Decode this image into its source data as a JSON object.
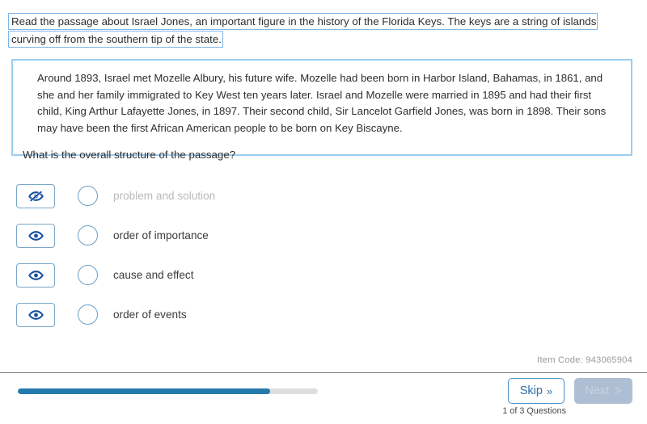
{
  "prompt": {
    "text": "Read the passage about Israel Jones, an important figure in the history of the Florida Keys. The keys are a string of islands curving off from the southern tip of the state."
  },
  "passage": {
    "body": "Around 1893, Israel met Mozelle Albury, his future wife. Mozelle had been born in Harbor Island, Bahamas, in 1861, and she and her family immigrated to Key West ten years later. Israel and Mozelle were married in 1895 and had their first child, King Arthur Lafayette Jones, in 1897. Their second child, Sir Lancelot Garfield Jones, was born in 1898. Their sons may have been the first African American people to be born on Key Biscayne.",
    "question": "What is the overall structure of the passage?"
  },
  "options": [
    {
      "label": "problem and solution",
      "eye_icon": "eye-off-icon",
      "eliminated": true,
      "selected": false
    },
    {
      "label": "order of importance",
      "eye_icon": "eye-icon",
      "eliminated": false,
      "selected": false
    },
    {
      "label": "cause and effect",
      "eye_icon": "eye-icon",
      "eliminated": false,
      "selected": false
    },
    {
      "label": "order of events",
      "eye_icon": "eye-icon",
      "eliminated": false,
      "selected": false
    }
  ],
  "footer": {
    "item_code": "Item Code: 943065904",
    "skip_label": "Skip",
    "skip_chevron": "»",
    "next_label": "Next",
    "next_chevron": ">",
    "question_counter": "1 of 3 Questions",
    "progress_percent": 84
  },
  "colors": {
    "accent_blue": "#2479ad",
    "icon_blue": "#174ea0",
    "box_border": "#9ccdf0",
    "prompt_border": "#7fb6e8",
    "progress_track": "#dedede",
    "disabled_button": "#aebfd4",
    "eliminated_text": "#b9b9b9"
  }
}
